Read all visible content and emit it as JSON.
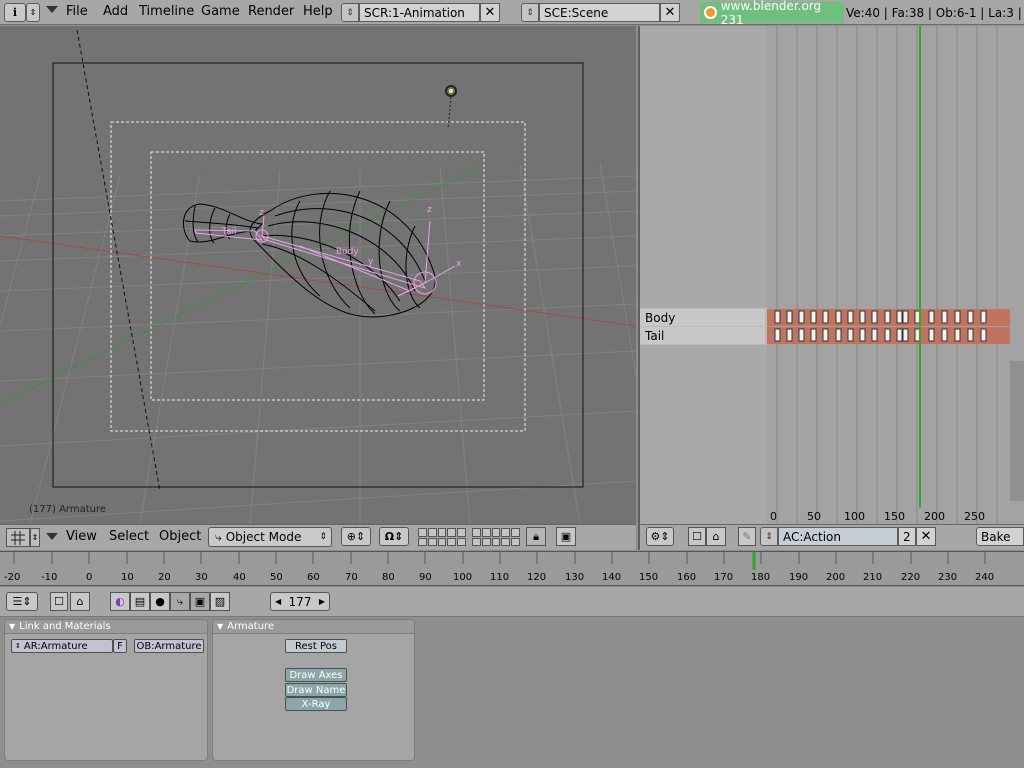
{
  "top_header": {
    "menus": [
      "File",
      "Add",
      "Timeline",
      "Game",
      "Render",
      "Help"
    ],
    "screen_field": "SCR:1-Animation",
    "scene_field": "SCE:Scene",
    "site_label": "www.blender.org 231",
    "stats": "Ve:40 | Fa:38 | Ob:6-1 | La:3 |"
  },
  "viewport": {
    "object_label": "(177) Armature",
    "bone_labels": [
      "Body",
      "y",
      "Tail",
      "z",
      "z"
    ],
    "axis_labels": [
      "z",
      "x",
      "y"
    ]
  },
  "view_header": {
    "menus": [
      "View",
      "Select",
      "Object"
    ],
    "mode": "Object Mode"
  },
  "action_editor": {
    "channels": [
      "Body",
      "Tail"
    ],
    "frame_ticks": [
      "0",
      "50",
      "100",
      "150",
      "200",
      "250"
    ],
    "action_field": "AC:Action",
    "users": "2",
    "bake_label": "Bake"
  },
  "ruler": {
    "ticks": [
      "-20",
      "-10",
      "0",
      "10",
      "20",
      "30",
      "40",
      "50",
      "60",
      "70",
      "80",
      "90",
      "100",
      "110",
      "120",
      "130",
      "140",
      "150",
      "160",
      "170",
      "180",
      "190",
      "200",
      "210",
      "220",
      "230",
      "240"
    ]
  },
  "buttons": {
    "frame": "177",
    "link_panel": {
      "title": "Link and Materials",
      "armature_field": "AR:Armature",
      "fake_user": "F",
      "object_field": "OB:Armature"
    },
    "armature_panel": {
      "title": "Armature",
      "rest_pos": "Rest Pos",
      "draw_axes": "Draw Axes",
      "draw_name": "Draw Name",
      "xray": "X-Ray"
    }
  },
  "colors": {
    "site_bg": "#6fbf7e",
    "keyframe": "#c0745f",
    "current_frame": "#2fa82f",
    "bone": "#e7a3e7"
  }
}
